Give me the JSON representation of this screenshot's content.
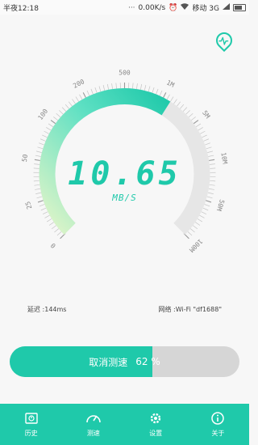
{
  "status_bar": {
    "time": "半夜12:18",
    "speed": "0.00K/s",
    "carrier": "移动 3G"
  },
  "gauge": {
    "ticks": [
      "0",
      "25",
      "50",
      "100",
      "200",
      "500",
      "1M",
      "5M",
      "10M",
      "50M",
      "100M"
    ],
    "progress_fraction": 0.62,
    "speed_value": "10.65",
    "speed_unit": "MB/S"
  },
  "info": {
    "latency": "延迟 :144ms",
    "network": "网络 :Wi-Fi \"df1688\""
  },
  "progress": {
    "label": "取消测速",
    "percent_text": "62 %",
    "fraction": 0.62
  },
  "tabs": [
    {
      "label": "历史",
      "icon": "history-icon"
    },
    {
      "label": "测速",
      "icon": "speedometer-icon"
    },
    {
      "label": "设置",
      "icon": "gear-icon"
    },
    {
      "label": "关于",
      "icon": "info-icon"
    }
  ],
  "colors": {
    "accent": "#1fc9aa",
    "accent_light": "#d4f3c8",
    "track": "#e6e6e6"
  }
}
